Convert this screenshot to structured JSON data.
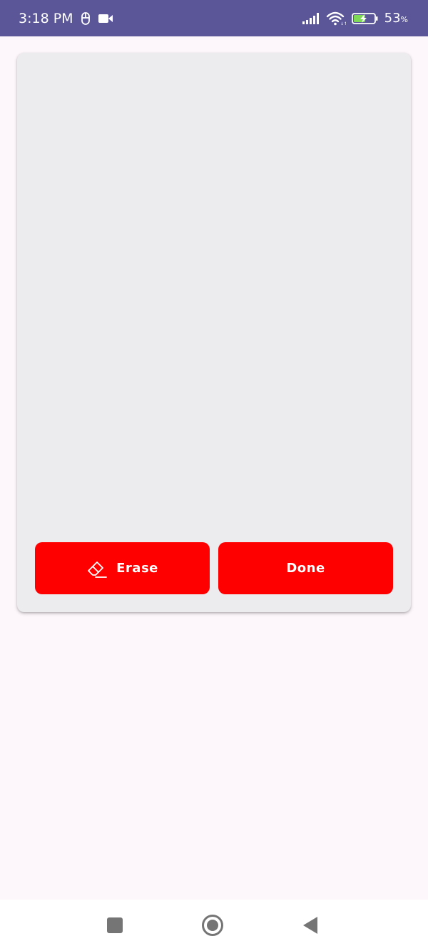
{
  "status_bar": {
    "time": "3:18 PM",
    "battery_percent": "53",
    "battery_percent_sign": "%",
    "background_color": "#5a5698",
    "icons": [
      "usb-debug-icon",
      "video-camera-icon",
      "signal-icon",
      "wifi-icon",
      "battery-charging-icon"
    ]
  },
  "signature_pad": {
    "background_color": "#ecebed"
  },
  "buttons": {
    "erase_label": "Erase",
    "erase_icon": "eraser-icon",
    "done_label": "Done",
    "color": "#ff0000"
  },
  "nav_bar": {
    "icons": [
      "recent-apps-icon",
      "home-icon",
      "back-icon"
    ]
  }
}
